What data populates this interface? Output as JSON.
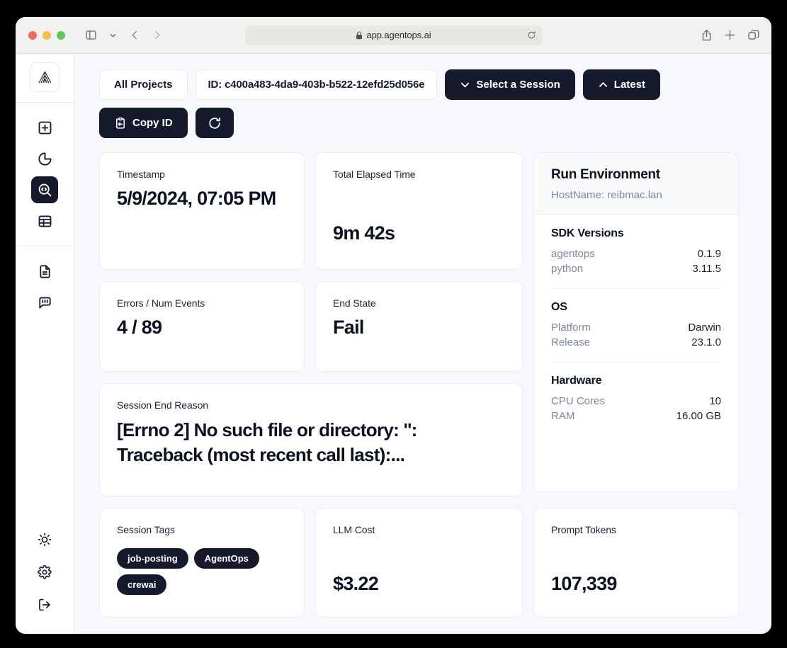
{
  "browser": {
    "url": "app.agentops.ai",
    "lock_icon": "lock-icon",
    "sidebar_toggle_icon": "sidebar-toggle-icon",
    "chevron_down_icon": "chevron-down-icon",
    "back_icon": "back-arrow-icon",
    "forward_icon": "forward-arrow-icon",
    "reload_icon": "reload-icon",
    "share_icon": "share-icon",
    "new_tab_icon": "plus-icon",
    "tabs_overview_icon": "tab-overview-icon"
  },
  "sidebar": {
    "logo_icon": "agentops-logo-icon",
    "items": [
      {
        "name": "new-session",
        "icon": "plus-square-icon",
        "active": false
      },
      {
        "name": "analytics",
        "icon": "pie-chart-icon",
        "active": false
      },
      {
        "name": "session-drilldown",
        "icon": "code-search-icon",
        "active": true
      },
      {
        "name": "sessions-table",
        "icon": "table-icon",
        "active": false
      }
    ],
    "secondary_items": [
      {
        "name": "docs",
        "icon": "document-icon"
      },
      {
        "name": "feedback",
        "icon": "chat-bot-icon"
      }
    ],
    "bottom_items": [
      {
        "name": "theme-toggle",
        "icon": "sun-icon"
      },
      {
        "name": "settings",
        "icon": "gear-icon"
      },
      {
        "name": "logout",
        "icon": "logout-icon"
      }
    ]
  },
  "toolbar": {
    "all_projects_label": "All Projects",
    "session_id_label": "ID: c400a483-4da9-403b-b522-12efd25d056e",
    "select_session_label": "Select a Session",
    "select_session_icon": "chevron-down-icon",
    "latest_label": "Latest",
    "latest_icon": "chevron-up-icon",
    "copy_id_label": "Copy ID",
    "copy_id_icon": "clipboard-paste-icon",
    "refresh_icon": "refresh-icon"
  },
  "cards": {
    "timestamp": {
      "label": "Timestamp",
      "value": "5/9/2024, 07:05 PM"
    },
    "elapsed": {
      "label": "Total Elapsed Time",
      "value": "9m 42s"
    },
    "errors": {
      "label": "Errors / Num Events",
      "value": "4 / 89"
    },
    "end_state": {
      "label": "End State",
      "value": "Fail"
    },
    "end_reason": {
      "label": "Session End Reason",
      "value": "[Errno 2] No such file or directory: '': Traceback (most recent call last):..."
    },
    "session_tags": {
      "label": "Session Tags",
      "tags": [
        "job-posting",
        "AgentOps",
        "crewai"
      ]
    },
    "llm_cost": {
      "label": "LLM Cost",
      "value": "$3.22"
    },
    "prompt_tokens": {
      "label": "Prompt Tokens",
      "value": "107,339"
    }
  },
  "run_environment": {
    "title": "Run Environment",
    "hostname": "HostName: reibmac.lan",
    "sections": [
      {
        "title": "SDK Versions",
        "rows": [
          {
            "key": "agentops",
            "value": "0.1.9"
          },
          {
            "key": "python",
            "value": "3.11.5"
          }
        ]
      },
      {
        "title": "OS",
        "rows": [
          {
            "key": "Platform",
            "value": "Darwin"
          },
          {
            "key": "Release",
            "value": "23.1.0"
          }
        ]
      },
      {
        "title": "Hardware",
        "rows": [
          {
            "key": "CPU Cores",
            "value": "10"
          },
          {
            "key": "RAM",
            "value": "16.00 GB"
          }
        ]
      }
    ]
  },
  "colors": {
    "dark_navy": "#161a2d",
    "page_bg": "#f6f8fb",
    "muted_text": "#7e879c",
    "card_border": "#e9ecf1"
  }
}
